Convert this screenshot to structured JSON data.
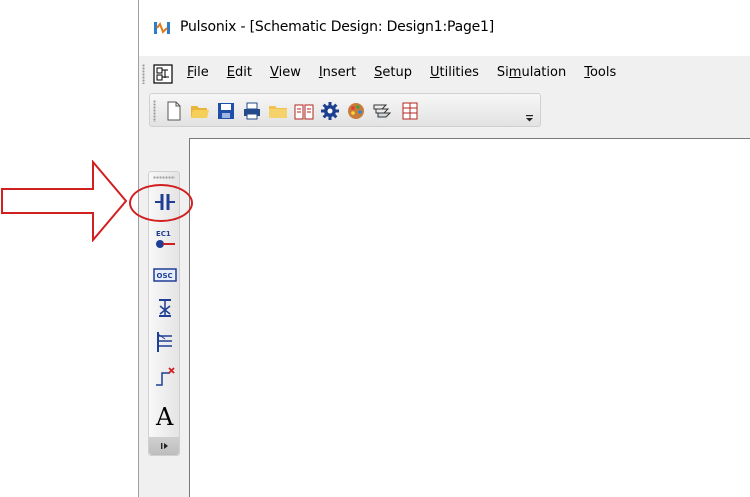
{
  "window": {
    "title": "Pulsonix - [Schematic Design: Design1:Page1]"
  },
  "menubar": {
    "items": [
      {
        "mnemonic": "F",
        "rest": "ile"
      },
      {
        "mnemonic": "E",
        "rest": "dit"
      },
      {
        "mnemonic": "V",
        "rest": "iew"
      },
      {
        "mnemonic": "I",
        "rest": "nsert"
      },
      {
        "mnemonic": "S",
        "rest": "etup"
      },
      {
        "mnemonic": "U",
        "rest": "tilities"
      },
      {
        "pre": "Si",
        "mnemonic": "m",
        "rest": "ulation"
      },
      {
        "mnemonic": "T",
        "rest": "ools"
      }
    ]
  },
  "toolbar": {
    "icons": [
      "new-document-icon",
      "open-folder-icon",
      "save-icon",
      "print-icon",
      "folder-icon",
      "library-book-icon",
      "settings-gear-icon",
      "palette-icon",
      "layers-icon",
      "component-grid-icon"
    ]
  },
  "vtoolbar": {
    "icons": [
      "capacitor-icon",
      "ec1-label",
      "osc-label",
      "ground-icon",
      "bus-icon",
      "net-end-icon",
      "text-icon"
    ],
    "ec1_text": "EC1",
    "osc_text": "OSC",
    "text_tool_glyph": "A"
  },
  "annotation": {
    "color": "#d21f1f"
  }
}
